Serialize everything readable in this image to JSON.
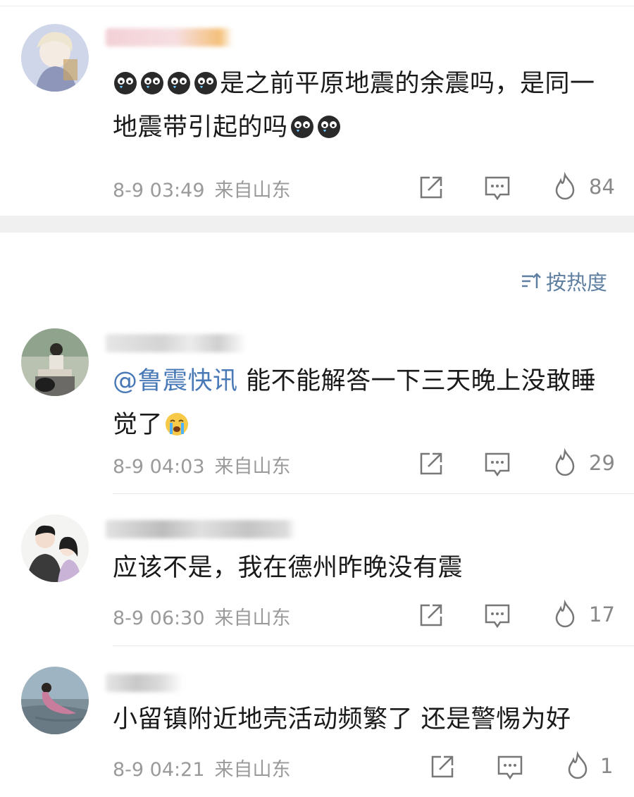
{
  "sort": {
    "label": "按热度"
  },
  "comments": [
    {
      "text_before": "",
      "mention": "",
      "text": "是之前平原地震的余震吗，是同一地震带引起的吗",
      "date": "8-9 03:49",
      "location": "来自山东",
      "likes": "84"
    },
    {
      "mention": "@鲁震快讯",
      "text": " 能不能解答一下三天晚上没敢睡觉了",
      "date": "8-9 04:03",
      "location": "来自山东",
      "likes": "29"
    },
    {
      "text": "应该不是，我在德州昨晚没有震",
      "date": "8-9 06:30",
      "location": "来自山东",
      "likes": "17"
    },
    {
      "text": "小留镇附近地壳活动频繁了 还是警惕为好",
      "date": "8-9 04:21",
      "location": "来自山东",
      "likes": "1"
    }
  ],
  "icons": {
    "share": "share-icon",
    "comment": "comment-icon",
    "like": "fire-icon",
    "sort": "sort-icon"
  },
  "colors": {
    "mention": "#4a79b7",
    "meta": "#9a9a9a",
    "separator": "#f0f0f0"
  }
}
